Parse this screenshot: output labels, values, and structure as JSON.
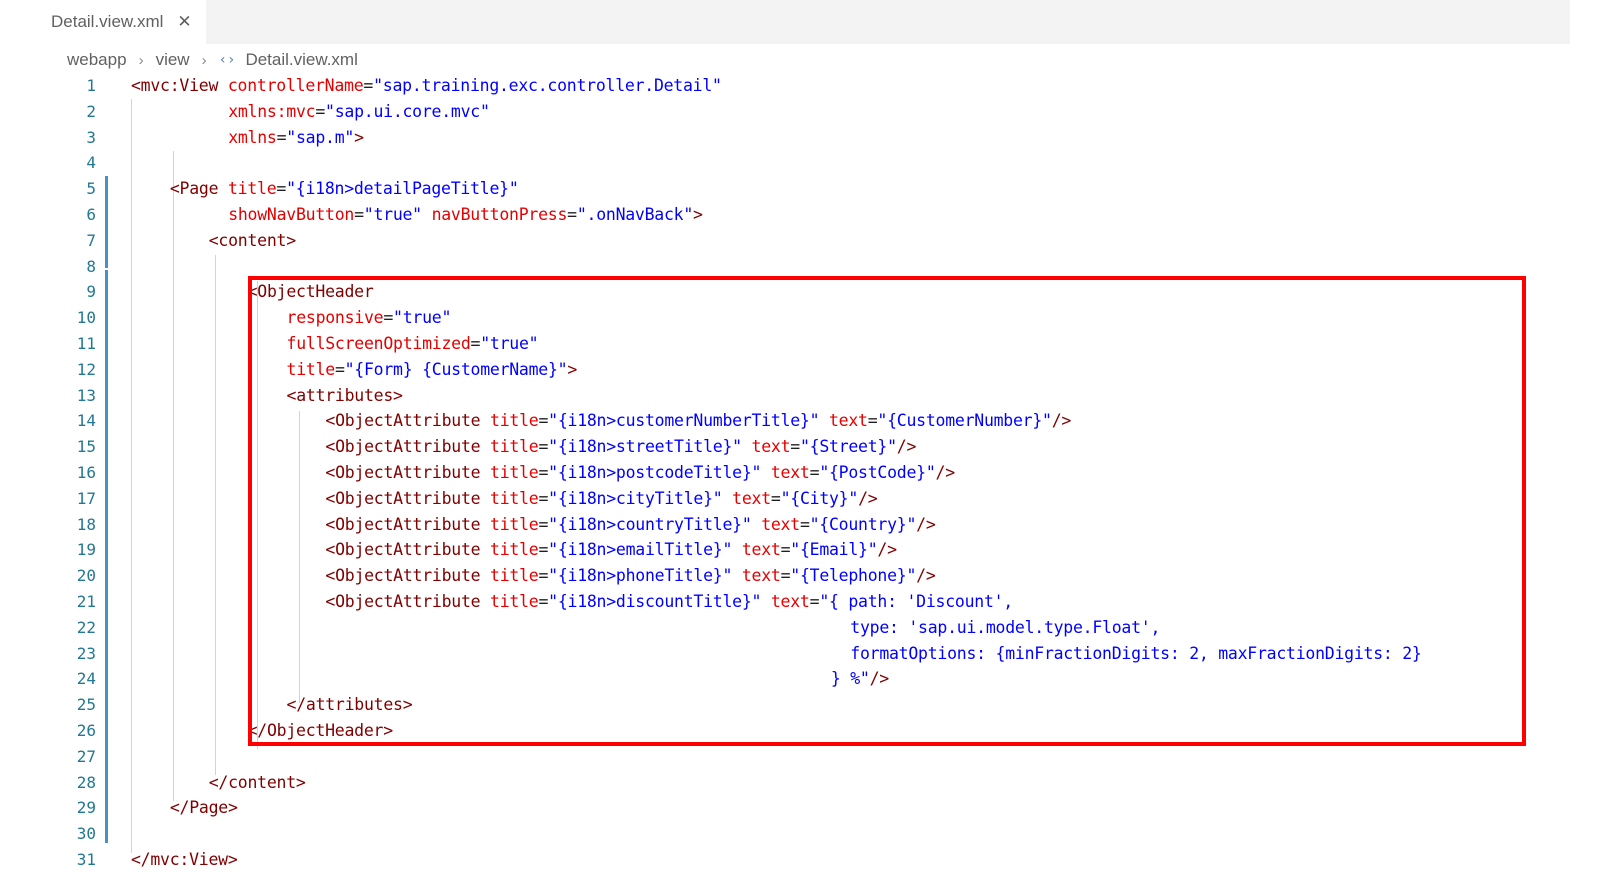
{
  "tab": {
    "filename": "Detail.view.xml",
    "close_glyph": "✕"
  },
  "breadcrumb": {
    "items": [
      "webapp",
      "view",
      "Detail.view.xml"
    ],
    "separator": "›",
    "file_icon": "‹›"
  },
  "colors": {
    "tag": "#800000",
    "attribute": "#e50000",
    "string": "#0000ff",
    "line_number": "#237893",
    "highlight_border": "#ff0000"
  },
  "lines": [
    {
      "num": "1",
      "indent": 0,
      "t": [
        [
          "tg",
          "<mvc:View "
        ],
        [
          "ke",
          "controllerName"
        ],
        [
          "eq",
          "="
        ],
        [
          "st",
          "\"sap.training.exc.controller.Detail\""
        ]
      ]
    },
    {
      "num": "2",
      "indent": 10,
      "t": [
        [
          "ke",
          "xmlns:mvc"
        ],
        [
          "eq",
          "="
        ],
        [
          "st",
          "\"sap.ui.core.mvc\""
        ]
      ]
    },
    {
      "num": "3",
      "indent": 10,
      "t": [
        [
          "ke",
          "xmlns"
        ],
        [
          "eq",
          "="
        ],
        [
          "st",
          "\"sap.m\""
        ],
        [
          "tg",
          ">"
        ]
      ]
    },
    {
      "num": "4",
      "indent": 0,
      "t": []
    },
    {
      "num": "5",
      "indent": 4,
      "t": [
        [
          "tg",
          "<Page "
        ],
        [
          "ke",
          "title"
        ],
        [
          "eq",
          "="
        ],
        [
          "st",
          "\"{i18n>detailPageTitle}\""
        ]
      ]
    },
    {
      "num": "6",
      "indent": 10,
      "t": [
        [
          "ke",
          "showNavButton"
        ],
        [
          "eq",
          "="
        ],
        [
          "st",
          "\"true\" "
        ],
        [
          "ke",
          "navButtonPress"
        ],
        [
          "eq",
          "="
        ],
        [
          "st",
          "\".onNavBack\""
        ],
        [
          "tg",
          ">"
        ]
      ]
    },
    {
      "num": "7",
      "indent": 8,
      "t": [
        [
          "tg",
          "<content>"
        ]
      ]
    },
    {
      "num": "8",
      "indent": 0,
      "t": []
    },
    {
      "num": "9",
      "indent": 12,
      "t": [
        [
          "tg",
          "<ObjectHeader"
        ]
      ]
    },
    {
      "num": "10",
      "indent": 16,
      "t": [
        [
          "ke",
          "responsive"
        ],
        [
          "eq",
          "="
        ],
        [
          "st",
          "\"true\""
        ]
      ]
    },
    {
      "num": "11",
      "indent": 16,
      "t": [
        [
          "ke",
          "fullScreenOptimized"
        ],
        [
          "eq",
          "="
        ],
        [
          "st",
          "\"true\""
        ]
      ]
    },
    {
      "num": "12",
      "indent": 16,
      "t": [
        [
          "ke",
          "title"
        ],
        [
          "eq",
          "="
        ],
        [
          "st",
          "\"{Form} {CustomerName}\""
        ],
        [
          "tg",
          ">"
        ]
      ]
    },
    {
      "num": "13",
      "indent": 16,
      "t": [
        [
          "tg",
          "<attributes>"
        ]
      ]
    },
    {
      "num": "14",
      "indent": 20,
      "t": [
        [
          "tg",
          "<ObjectAttribute "
        ],
        [
          "ke",
          "title"
        ],
        [
          "eq",
          "="
        ],
        [
          "st",
          "\"{i18n>customerNumberTitle}\" "
        ],
        [
          "ke",
          "text"
        ],
        [
          "eq",
          "="
        ],
        [
          "st",
          "\"{CustomerNumber}\""
        ],
        [
          "tg",
          "/>"
        ]
      ]
    },
    {
      "num": "15",
      "indent": 20,
      "t": [
        [
          "tg",
          "<ObjectAttribute "
        ],
        [
          "ke",
          "title"
        ],
        [
          "eq",
          "="
        ],
        [
          "st",
          "\"{i18n>streetTitle}\" "
        ],
        [
          "ke",
          "text"
        ],
        [
          "eq",
          "="
        ],
        [
          "st",
          "\"{Street}\""
        ],
        [
          "tg",
          "/>"
        ]
      ]
    },
    {
      "num": "16",
      "indent": 20,
      "t": [
        [
          "tg",
          "<ObjectAttribute "
        ],
        [
          "ke",
          "title"
        ],
        [
          "eq",
          "="
        ],
        [
          "st",
          "\"{i18n>postcodeTitle}\" "
        ],
        [
          "ke",
          "text"
        ],
        [
          "eq",
          "="
        ],
        [
          "st",
          "\"{PostCode}\""
        ],
        [
          "tg",
          "/>"
        ]
      ]
    },
    {
      "num": "17",
      "indent": 20,
      "t": [
        [
          "tg",
          "<ObjectAttribute "
        ],
        [
          "ke",
          "title"
        ],
        [
          "eq",
          "="
        ],
        [
          "st",
          "\"{i18n>cityTitle}\" "
        ],
        [
          "ke",
          "text"
        ],
        [
          "eq",
          "="
        ],
        [
          "st",
          "\"{City}\""
        ],
        [
          "tg",
          "/>"
        ]
      ]
    },
    {
      "num": "18",
      "indent": 20,
      "t": [
        [
          "tg",
          "<ObjectAttribute "
        ],
        [
          "ke",
          "title"
        ],
        [
          "eq",
          "="
        ],
        [
          "st",
          "\"{i18n>countryTitle}\" "
        ],
        [
          "ke",
          "text"
        ],
        [
          "eq",
          "="
        ],
        [
          "st",
          "\"{Country}\""
        ],
        [
          "tg",
          "/>"
        ]
      ]
    },
    {
      "num": "19",
      "indent": 20,
      "t": [
        [
          "tg",
          "<ObjectAttribute "
        ],
        [
          "ke",
          "title"
        ],
        [
          "eq",
          "="
        ],
        [
          "st",
          "\"{i18n>emailTitle}\" "
        ],
        [
          "ke",
          "text"
        ],
        [
          "eq",
          "="
        ],
        [
          "st",
          "\"{Email}\""
        ],
        [
          "tg",
          "/>"
        ]
      ]
    },
    {
      "num": "20",
      "indent": 20,
      "t": [
        [
          "tg",
          "<ObjectAttribute "
        ],
        [
          "ke",
          "title"
        ],
        [
          "eq",
          "="
        ],
        [
          "st",
          "\"{i18n>phoneTitle}\" "
        ],
        [
          "ke",
          "text"
        ],
        [
          "eq",
          "="
        ],
        [
          "st",
          "\"{Telephone}\""
        ],
        [
          "tg",
          "/>"
        ]
      ]
    },
    {
      "num": "21",
      "indent": 20,
      "t": [
        [
          "tg",
          "<ObjectAttribute "
        ],
        [
          "ke",
          "title"
        ],
        [
          "eq",
          "="
        ],
        [
          "st",
          "\"{i18n>discountTitle}\" "
        ],
        [
          "ke",
          "text"
        ],
        [
          "eq",
          "="
        ],
        [
          "st",
          "\"{ path: 'Discount',"
        ]
      ]
    },
    {
      "num": "22",
      "indent": 74,
      "t": [
        [
          "st",
          "type: 'sap.ui.model.type.Float',"
        ]
      ]
    },
    {
      "num": "23",
      "indent": 74,
      "t": [
        [
          "st",
          "formatOptions: {minFractionDigits: 2, maxFractionDigits: 2}"
        ]
      ]
    },
    {
      "num": "24",
      "indent": 72,
      "t": [
        [
          "st",
          "} %\""
        ],
        [
          "tg",
          "/>"
        ]
      ]
    },
    {
      "num": "25",
      "indent": 16,
      "t": [
        [
          "tg",
          "</attributes>"
        ]
      ]
    },
    {
      "num": "26",
      "indent": 12,
      "t": [
        [
          "tg",
          "</ObjectHeader>"
        ]
      ]
    },
    {
      "num": "27",
      "indent": 0,
      "t": []
    },
    {
      "num": "28",
      "indent": 8,
      "t": [
        [
          "tg",
          "</content>"
        ]
      ]
    },
    {
      "num": "29",
      "indent": 4,
      "t": [
        [
          "tg",
          "</Page>"
        ]
      ]
    },
    {
      "num": "30",
      "indent": 0,
      "t": []
    },
    {
      "num": "31",
      "indent": 0,
      "t": [
        [
          "tg",
          "</mvc:View>"
        ]
      ]
    }
  ]
}
